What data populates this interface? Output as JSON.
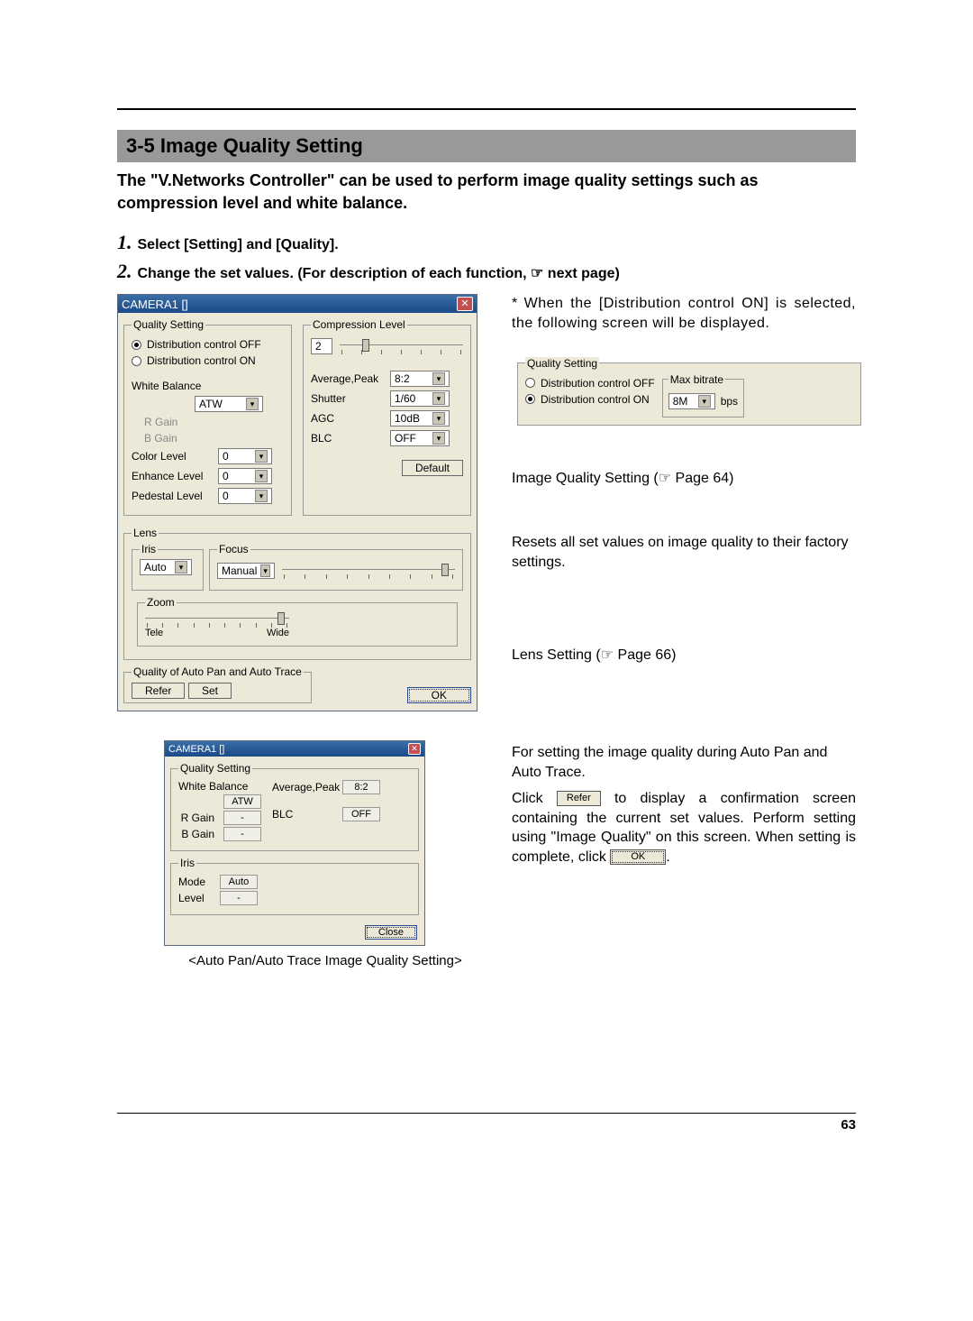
{
  "section_title": "3-5 Image Quality Setting",
  "intro": "The \"V.Networks Controller\" can be used to perform image quality settings such as compression level and white balance.",
  "steps": [
    {
      "num": "1.",
      "text": "Select [Setting] and [Quality]."
    },
    {
      "num": "2.",
      "text": "Change the set values. (For description of each function, ☞ next page)"
    }
  ],
  "main_dialog": {
    "title": "CAMERA1  []",
    "quality_setting_legend": "Quality Setting",
    "dist_off": "Distribution control OFF",
    "dist_on": "Distribution control ON",
    "white_balance_label": "White Balance",
    "white_balance_value": "ATW",
    "r_gain": "R Gain",
    "b_gain": "B Gain",
    "color_level_label": "Color Level",
    "color_level_value": "0",
    "enhance_level_label": "Enhance Level",
    "enhance_level_value": "0",
    "pedestal_level_label": "Pedestal Level",
    "pedestal_level_value": "0",
    "compression_legend": "Compression Level",
    "compression_value": "2",
    "avg_peak_label": "Average,Peak",
    "avg_peak_value": "8:2",
    "shutter_label": "Shutter",
    "shutter_value": "1/60",
    "agc_label": "AGC",
    "agc_value": "10dB",
    "blc_label": "BLC",
    "blc_value": "OFF",
    "default_btn": "Default",
    "lens_legend": "Lens",
    "iris_legend": "Iris",
    "iris_value": "Auto",
    "focus_legend": "Focus",
    "focus_value": "Manual",
    "zoom_legend": "Zoom",
    "zoom_tele": "Tele",
    "zoom_wide": "Wide",
    "autopan_legend": "Quality of Auto Pan and Auto Trace",
    "refer_btn": "Refer",
    "set_btn": "Set",
    "ok_btn": "OK"
  },
  "right": {
    "star_note_prefix": "*",
    "star_note": "When the [Distribution control ON] is selected, the following screen will be displayed.",
    "snippet": {
      "legend": "Quality Setting",
      "dist_off": "Distribution control OFF",
      "dist_on": "Distribution control ON",
      "max_bitrate_legend": "Max bitrate",
      "max_bitrate_value": "8M",
      "bps": "bps"
    },
    "iq_setting": "Image Quality Setting (☞ Page 64)",
    "reset_note": "Resets all set values on image quality to their factory settings.",
    "lens_setting": "Lens Setting (☞ Page 66)",
    "autopan_note": "For setting the image quality during Auto Pan and Auto Trace.",
    "click_prefix": "Click ",
    "refer_btn": "Refer",
    "click_mid": " to display a confirmation screen containing the current set values. Perform setting using \"Image Quality\" on this screen. When setting is complete, click ",
    "ok_btn": "OK",
    "period": "."
  },
  "confirm_dialog": {
    "title": "CAMERA1  []",
    "quality_setting_legend": "Quality Setting",
    "white_balance_label": "White Balance",
    "white_balance_value": "ATW",
    "r_gain": "R Gain",
    "b_gain": "B Gain",
    "dash": "-",
    "avg_peak_label": "Average,Peak",
    "avg_peak_value": "8:2",
    "blc_label": "BLC",
    "blc_value": "OFF",
    "iris_legend": "Iris",
    "mode_label": "Mode",
    "mode_value": "Auto",
    "level_label": "Level",
    "level_value": "-",
    "close_btn": "Close"
  },
  "confirm_caption": "<Auto Pan/Auto Trace Image Quality Setting>",
  "page_number": "63"
}
